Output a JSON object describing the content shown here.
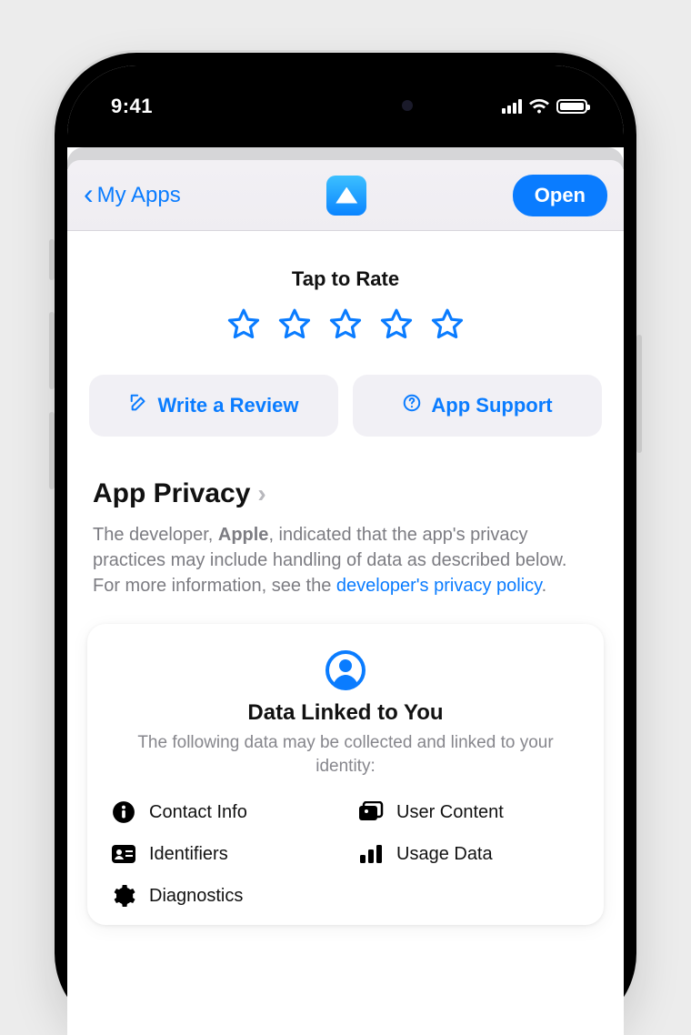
{
  "status": {
    "time": "9:41"
  },
  "nav": {
    "back_label": "My Apps",
    "open_label": "Open"
  },
  "rate": {
    "title": "Tap to Rate"
  },
  "actions": {
    "review_label": "Write a Review",
    "support_label": "App Support"
  },
  "privacy": {
    "heading": "App Privacy",
    "body_pre": "The developer, ",
    "developer": "Apple",
    "body_post": ", indicated that the app's privacy practices may include handling of data as described below. For more information, see the ",
    "link_label": "developer's privacy policy",
    "card": {
      "title": "Data Linked to You",
      "subtitle": "The following data may be collected and linked to your identity:",
      "items": [
        {
          "label": "Contact Info",
          "icon": "info-circle-icon"
        },
        {
          "label": "User Content",
          "icon": "photos-icon"
        },
        {
          "label": "Identifiers",
          "icon": "id-card-icon"
        },
        {
          "label": "Usage Data",
          "icon": "bar-chart-icon"
        },
        {
          "label": "Diagnostics",
          "icon": "gear-icon"
        }
      ]
    }
  }
}
